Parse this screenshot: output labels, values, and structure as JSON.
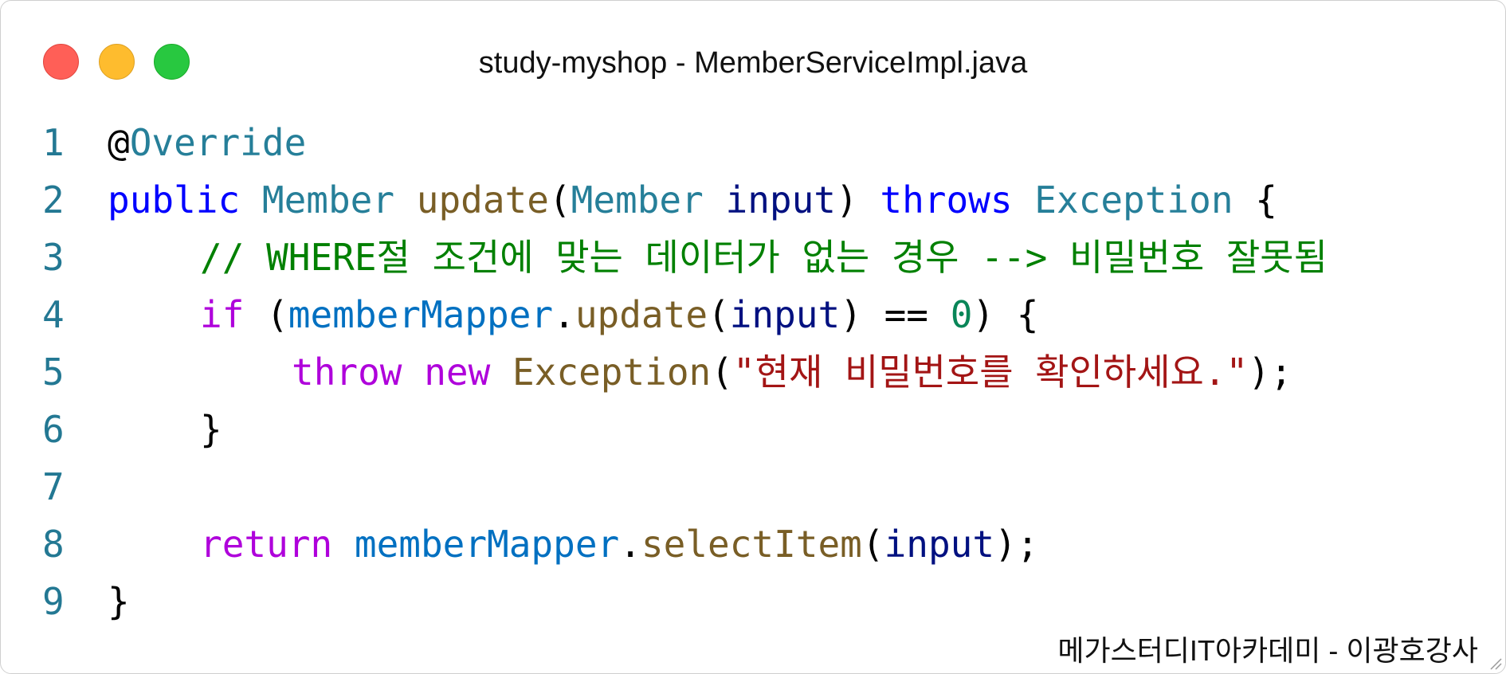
{
  "window": {
    "title": "study-myshop - MemberServiceImpl.java"
  },
  "code": {
    "line_numbers": [
      "1",
      "2",
      "3",
      "4",
      "5",
      "6",
      "7",
      "8",
      "9"
    ],
    "line1": {
      "at": "@",
      "annotation": "Override"
    },
    "line2": {
      "public": "public",
      "return_type": "Member",
      "method": "update",
      "open_paren": "(",
      "param_type": "Member",
      "param_name": "input",
      "close_paren": ")",
      "throws": "throws",
      "exception": "Exception",
      "brace": "{"
    },
    "line3": {
      "comment": "// WHERE절 조건에 맞는 데이터가 없는 경우 --> 비밀번호 잘못됨"
    },
    "line4": {
      "if": "if",
      "open_paren": "(",
      "mapper": "memberMapper",
      "dot": ".",
      "method": "update",
      "paren_open": "(",
      "arg": "input",
      "paren_close": ")",
      "op": " == ",
      "zero": "0",
      "close": ") {"
    },
    "line5": {
      "throw": "throw",
      "new": "new",
      "exception": "Exception",
      "open_paren": "(",
      "message": "\"현재 비밀번호를 확인하세요.\"",
      "close": ");"
    },
    "line6": {
      "brace": "}"
    },
    "line8": {
      "return": "return",
      "mapper": "memberMapper",
      "dot": ".",
      "method": "selectItem",
      "open_paren": "(",
      "arg": "input",
      "close": ");"
    },
    "line9": {
      "brace": "}"
    }
  },
  "watermark": "메가스터디IT아카데미 - 이광호강사",
  "colors": {
    "close": "#ff5f57",
    "minimize": "#febc2e",
    "maximize": "#28c840",
    "line_number": "#237893",
    "keyword_blue": "#0000ff",
    "keyword_purple": "#af00db",
    "type": "#267f99",
    "function": "#795e26",
    "variable": "#001080",
    "object": "#0070c1",
    "number": "#098658",
    "string": "#a31515",
    "comment": "#008000"
  }
}
